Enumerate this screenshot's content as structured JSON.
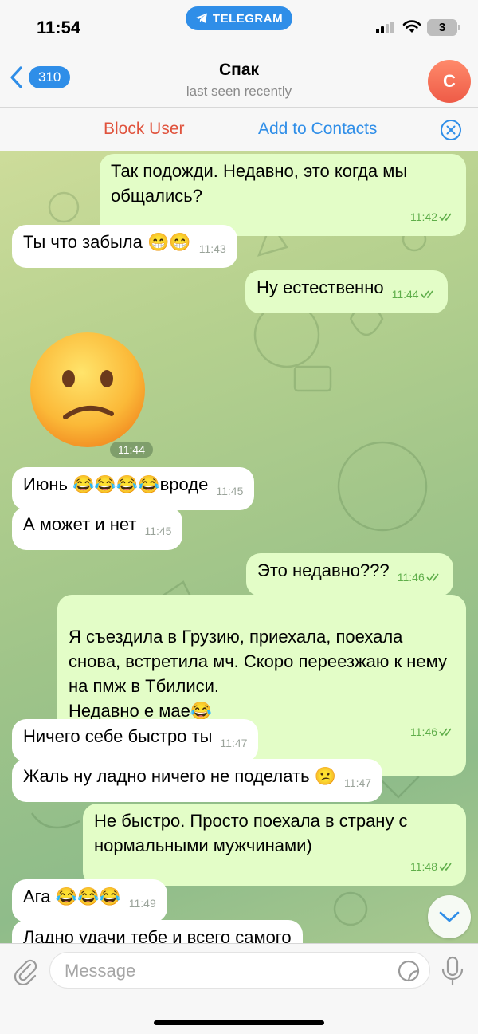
{
  "status_bar": {
    "time": "11:54",
    "app_pill": "TELEGRAM",
    "battery": "3"
  },
  "header": {
    "back_count": "310",
    "title": "Спак",
    "subtitle": "last seen recently",
    "avatar_letter": "С"
  },
  "action_bar": {
    "block": "Block User",
    "add": "Add to Contacts"
  },
  "messages": [
    {
      "dir": "out",
      "text": "Так подожди. Недавно, это когда мы общались?",
      "time": "11:42"
    },
    {
      "dir": "in",
      "text": "Ты что забыла 😁😁",
      "time": "11:43"
    },
    {
      "dir": "out",
      "text": "Ну естественно",
      "time": "11:44"
    },
    {
      "dir": "in",
      "sticker": "confused-face",
      "time": "11:44"
    },
    {
      "dir": "in",
      "text": "Июнь 😂😂😂😂вроде",
      "time": "11:45"
    },
    {
      "dir": "in",
      "text": "А может и нет",
      "time": "11:45"
    },
    {
      "dir": "out",
      "text": "Это недавно???",
      "time": "11:46"
    },
    {
      "dir": "out",
      "text": "Я съездила в Грузию, приехала, поехала снова, встретила мч. Скоро переезжаю к нему на пмж в Тбилиси.\nНедавно е мае😂",
      "time": "11:46"
    },
    {
      "dir": "in",
      "text": "Ничего себе быстро ты",
      "time": "11:47"
    },
    {
      "dir": "in",
      "text": "Жаль ну ладно ничего не поделать 😕",
      "time": "11:47"
    },
    {
      "dir": "out",
      "text": "Не быстро. Просто поехала в страну с нормальными мужчинами)",
      "time": "11:48"
    },
    {
      "dir": "in",
      "text": "Ага 😂😂😂",
      "time": "11:49"
    },
    {
      "dir": "in",
      "text": "Ладно удачи тебе и всего самого"
    }
  ],
  "input": {
    "placeholder": "Message"
  },
  "colors": {
    "accent": "#2f8ee8",
    "danger": "#e0533d",
    "outgoing": "#e3fdc7",
    "incoming": "#ffffff",
    "check": "#5fae4a"
  }
}
